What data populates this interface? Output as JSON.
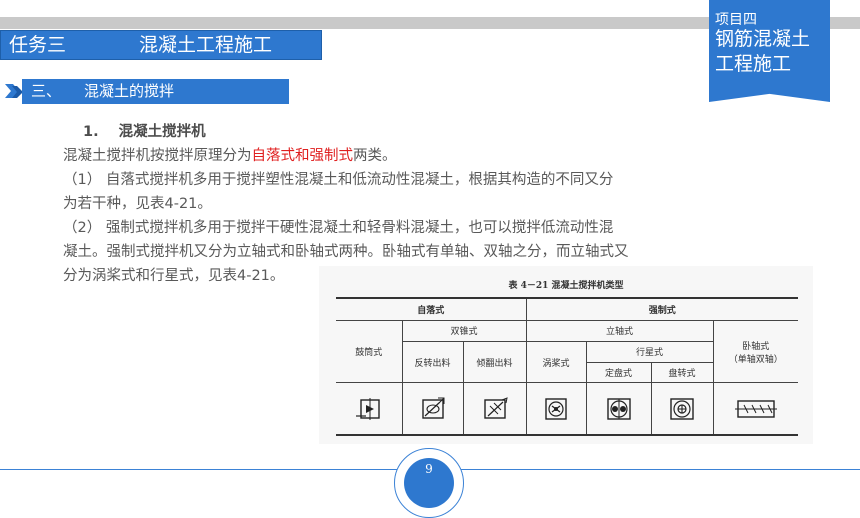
{
  "task_banner": {
    "number": "任务三",
    "title": "混凝土工程施工"
  },
  "project_flag": {
    "label": "项目四",
    "title_line1": "钢筋混凝土",
    "title_line2": "工程施工"
  },
  "section": {
    "number": "三、",
    "title": "混凝土的搅拌"
  },
  "heading": {
    "number": "1.",
    "title": "混凝土搅拌机"
  },
  "body": {
    "line1_pre": "混凝土搅拌机按搅拌原理分为",
    "line1_red": "自落式和强制式",
    "line1_post": "两类。",
    "p1_line1": "（1）  自落式搅拌机多用于搅拌塑性混凝土和低流动性混凝土，根据其构造的不同又分",
    "p1_line2": "为若干种，见表4-21。",
    "p2_line1": "（2）  强制式搅拌机多用于搅拌干硬性混凝土和轻骨料混凝土，也可以搅拌低流动性混",
    "p2_line2": "凝土。强制式搅拌机又分为立轴式和卧轴式两种。卧轴式有单轴、双轴之分，而立轴式又",
    "p2_line3": "分为涡桨式和行星式，见表4-21。"
  },
  "table": {
    "caption": "表 4－21  混凝土搅拌机类型",
    "free_fall": "自落式",
    "forced": "强制式",
    "double_cone": "双锥式",
    "vertical_shaft": "立轴式",
    "drum": "鼓筒式",
    "reverse_discharge": "反转出料",
    "tilt_discharge": "倾翻出料",
    "turbine": "涡桨式",
    "planetary": "行星式",
    "fixed_disc": "定盘式",
    "rotating_disc": "盘转式",
    "horizontal_shaft": "卧轴式",
    "horizontal_shaft_sub": "（单轴双轴）"
  },
  "page_number": "9",
  "colors": {
    "accent": "#2e78cf",
    "highlight": "#e02020",
    "text": "#595959"
  }
}
